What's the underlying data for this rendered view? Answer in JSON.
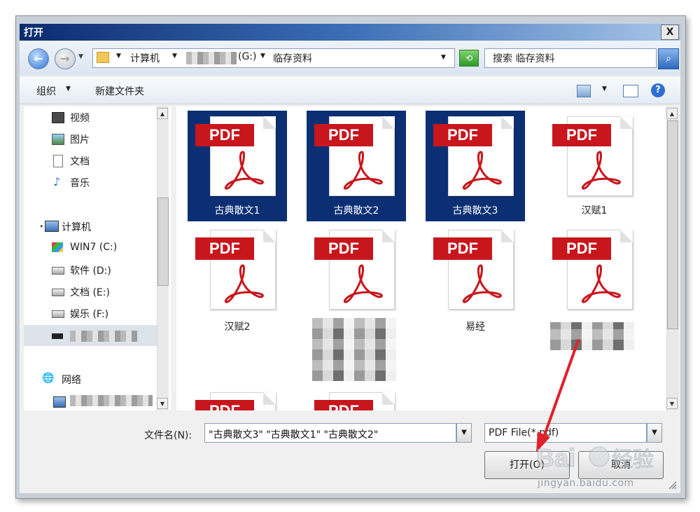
{
  "window": {
    "title": "打开",
    "close_label": "X"
  },
  "address": {
    "path": [
      "计算机",
      "(G:)",
      "临存资料"
    ],
    "search_placeholder": "搜索 临存资料"
  },
  "toolbar": {
    "organize": "组织",
    "new_folder": "新建文件夹",
    "help": "?"
  },
  "sidebar": {
    "libraries": [
      {
        "label": "视频",
        "icon": "video-icon"
      },
      {
        "label": "图片",
        "icon": "image-icon"
      },
      {
        "label": "文档",
        "icon": "document-icon"
      },
      {
        "label": "音乐",
        "icon": "music-icon"
      }
    ],
    "computer": "计算机",
    "drives": [
      {
        "label": "WIN7 (C:)",
        "icon": "system-drive-icon"
      },
      {
        "label": "软件 (D:)",
        "icon": "drive-icon"
      },
      {
        "label": "文档 (E:)",
        "icon": "drive-icon"
      },
      {
        "label": "娱乐 (F:)",
        "icon": "drive-icon"
      }
    ],
    "network": "网络"
  },
  "files": [
    {
      "label": "古典散文1",
      "selected": true
    },
    {
      "label": "古典散文2",
      "selected": true
    },
    {
      "label": "古典散文3",
      "selected": true
    },
    {
      "label": "汉赋1",
      "selected": false
    },
    {
      "label": "汉赋2",
      "selected": false
    },
    {
      "label": "",
      "selected": false
    },
    {
      "label": "易经",
      "selected": false
    },
    {
      "label": "",
      "selected": false
    }
  ],
  "pdf_badge": "PDF",
  "bottom": {
    "filename_label": "文件名(N):",
    "filename_value": "\"古典散文3\" \"古典散文1\" \"古典散文2\"",
    "filetype_value": "PDF File(*.pdf)",
    "open_button": "打开(O)",
    "cancel_button": "取消"
  },
  "watermark": {
    "url": "jingyan.baidu.com"
  },
  "colors": {
    "selection": "#0c2f74",
    "pdf_red": "#c8161d",
    "titlebar": "#0c2a6e"
  }
}
